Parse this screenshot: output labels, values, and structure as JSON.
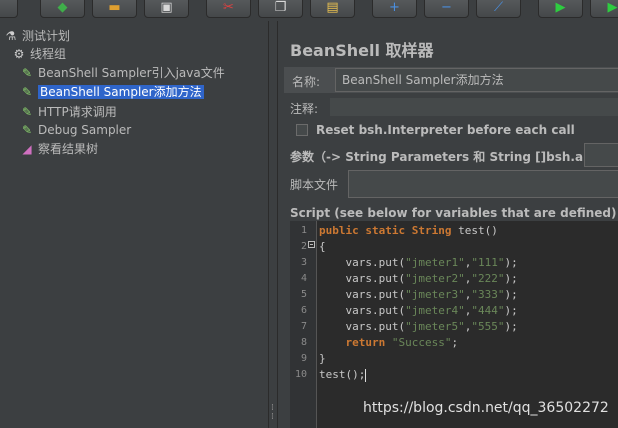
{
  "toolbar": {
    "buttons": [
      {
        "name": "new-icon",
        "glyph": "▮",
        "color": "#cfcfcf"
      },
      {
        "name": "templates-icon",
        "glyph": "◆",
        "color": "#3fae4a"
      },
      {
        "name": "open-icon",
        "glyph": "▬",
        "color": "#e0a030"
      },
      {
        "name": "save-icon",
        "glyph": "▣",
        "color": "#d8d8d8"
      },
      {
        "name": "cut-icon",
        "glyph": "✂",
        "color": "#e04040"
      },
      {
        "name": "copy-icon",
        "glyph": "❐",
        "color": "#d8d8d8"
      },
      {
        "name": "paste-icon",
        "glyph": "▤",
        "color": "#e8c050"
      },
      {
        "name": "expand-icon",
        "glyph": "+",
        "color": "#4a90e2"
      },
      {
        "name": "collapse-icon",
        "glyph": "−",
        "color": "#4a90e2"
      },
      {
        "name": "toggle-icon",
        "glyph": "⟋",
        "color": "#4a90e2"
      },
      {
        "name": "start-icon",
        "glyph": "▶",
        "color": "#2ecc40"
      },
      {
        "name": "start-no-pause-icon",
        "glyph": "▶",
        "color": "#2ecc40"
      }
    ]
  },
  "tree": {
    "items": [
      {
        "label": "测试计划",
        "icon": "flask-icon",
        "glyph": "⚗",
        "indent": 0,
        "selected": false
      },
      {
        "label": "线程组",
        "icon": "gear-icon",
        "glyph": "⚙",
        "indent": 1,
        "selected": false
      },
      {
        "label": "BeanShell Sampler引入java文件",
        "icon": "pipette-icon",
        "glyph": "✎",
        "indent": 2,
        "selected": false
      },
      {
        "label": "BeanShell Sampler添加方法",
        "icon": "pipette-icon",
        "glyph": "✎",
        "indent": 2,
        "selected": true
      },
      {
        "label": "HTTP请求调用",
        "icon": "pipette-icon",
        "glyph": "✎",
        "indent": 2,
        "selected": false
      },
      {
        "label": "Debug Sampler",
        "icon": "pipette-icon",
        "glyph": "✎",
        "indent": 2,
        "selected": false
      },
      {
        "label": "察看结果树",
        "icon": "chart-icon",
        "glyph": "◢",
        "indent": 2,
        "selected": false
      }
    ]
  },
  "panel": {
    "title": "BeanShell 取样器",
    "name_label": "名称:",
    "name_value": "BeanShell Sampler添加方法",
    "comment_label": "注释:",
    "comment_value": "",
    "reset_label": "Reset bsh.Interpreter before each call",
    "reset_checked": false,
    "params_label": "参数（-> String Parameters 和 String []bsh.args）",
    "params_value": "",
    "script_file_label": "脚本文件",
    "script_file_value": "",
    "script_heading": "Script (see below for variables that are defined)"
  },
  "script": {
    "lines": [
      "public static String test()",
      "{",
      "    vars.put(\"jmeter1\",\"111\");",
      "    vars.put(\"jmeter2\",\"222\");",
      "    vars.put(\"jmeter3\",\"333\");",
      "    vars.put(\"jmeter4\",\"444\");",
      "    vars.put(\"jmeter5\",\"555\");",
      "    return \"Success\";",
      "}",
      "test();"
    ]
  },
  "watermark": "https://blog.csdn.net/qq_36502272"
}
